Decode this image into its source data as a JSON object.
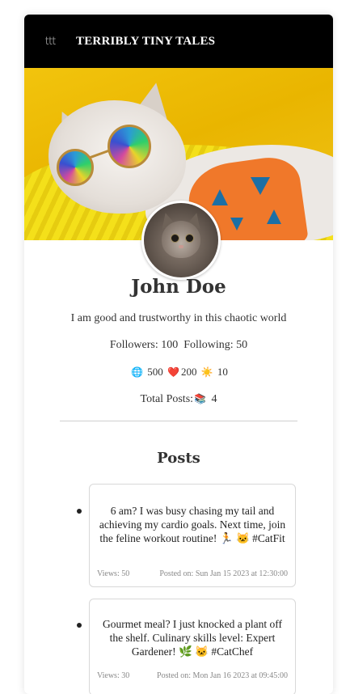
{
  "header": {
    "logo": "ttt",
    "title": "TERRIBLY TINY TALES"
  },
  "profile": {
    "name": "John Doe",
    "bio": "I am good and trustworthy in this chaotic world",
    "followers_label": "Followers:",
    "followers": "100",
    "following_label": "Following:",
    "following": "50",
    "stats": [
      {
        "icon": "globe-icon",
        "glyph": "🌐",
        "value": "500"
      },
      {
        "icon": "heart-icon",
        "glyph": "❤️",
        "value": "200"
      },
      {
        "icon": "sun-icon",
        "glyph": "☀️",
        "value": "10"
      }
    ],
    "total_posts_label": "Total Posts:",
    "total_posts_glyph": "📚",
    "total_posts": "4"
  },
  "posts_heading": "Posts",
  "posts": [
    {
      "text": "6 am? I was busy chasing my tail and achieving my cardio goals. Next time, join the feline workout routine! 🏃 🐱 #CatFit",
      "views": "Views: 50",
      "posted": "Posted on: Sun Jan 15 2023 at 12:30:00"
    },
    {
      "text": "Gourmet meal? I just knocked a plant off the shelf. Culinary skills level: Expert Gardener! 🌿 🐱 #CatChef",
      "views": "Views: 30",
      "posted": "Posted on: Mon Jan 16 2023 at 09:45:00"
    }
  ],
  "colors": {
    "header_bg": "#000000",
    "cover_bg": "#f2c40d",
    "divider": "#cfcfcf"
  }
}
